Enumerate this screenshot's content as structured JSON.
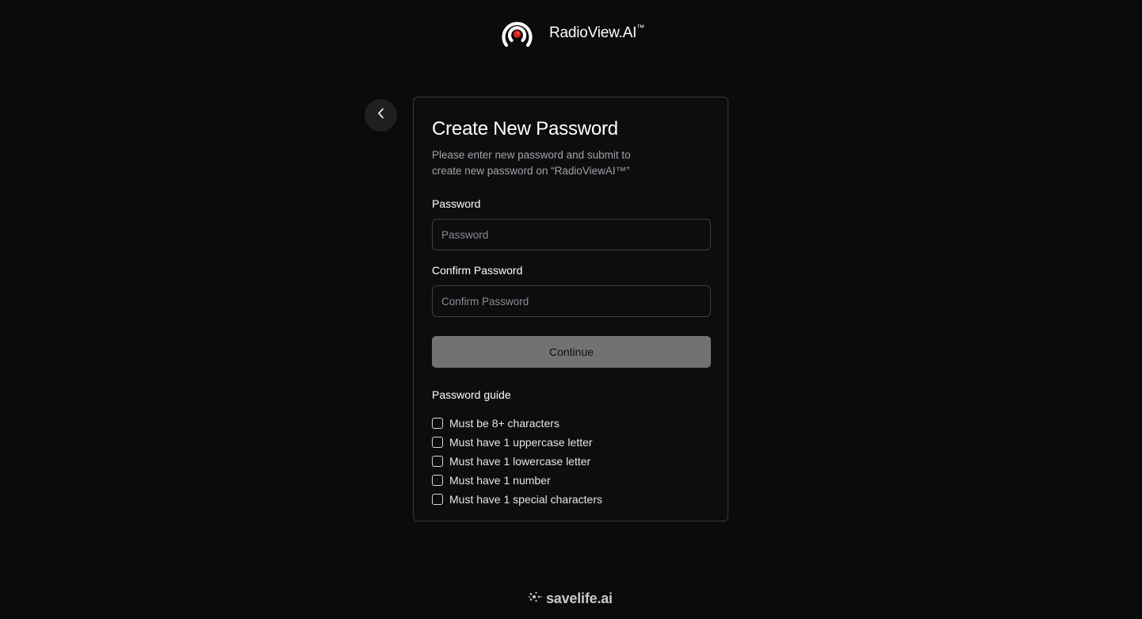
{
  "brand": {
    "name": "RadioView.AI",
    "trademark": "™",
    "logo_icon": "radio-signal-icon",
    "accent_color": "#e0241c"
  },
  "back_button": {
    "icon": "chevron-left-icon"
  },
  "card": {
    "title": "Create New Password",
    "subtitle_line1": "Please enter new password and submit to",
    "subtitle_line2": "create new password on “RadioViewAI™”"
  },
  "form": {
    "password_label": "Password",
    "password_placeholder": "Password",
    "password_value": "",
    "confirm_label": "Confirm Password",
    "confirm_placeholder": "Confirm Password",
    "confirm_value": "",
    "continue_label": "Continue"
  },
  "guide": {
    "title": "Password guide",
    "items": [
      {
        "label": "Must be 8+ characters",
        "checked": false
      },
      {
        "label": "Must have 1 uppercase letter",
        "checked": false
      },
      {
        "label": "Must have 1 lowercase letter",
        "checked": false
      },
      {
        "label": "Must have 1 number",
        "checked": false
      },
      {
        "label": "Must have 1 special characters",
        "checked": false
      }
    ]
  },
  "footer": {
    "name": "savelife.ai",
    "icon": "sparkle-dots-icon"
  }
}
